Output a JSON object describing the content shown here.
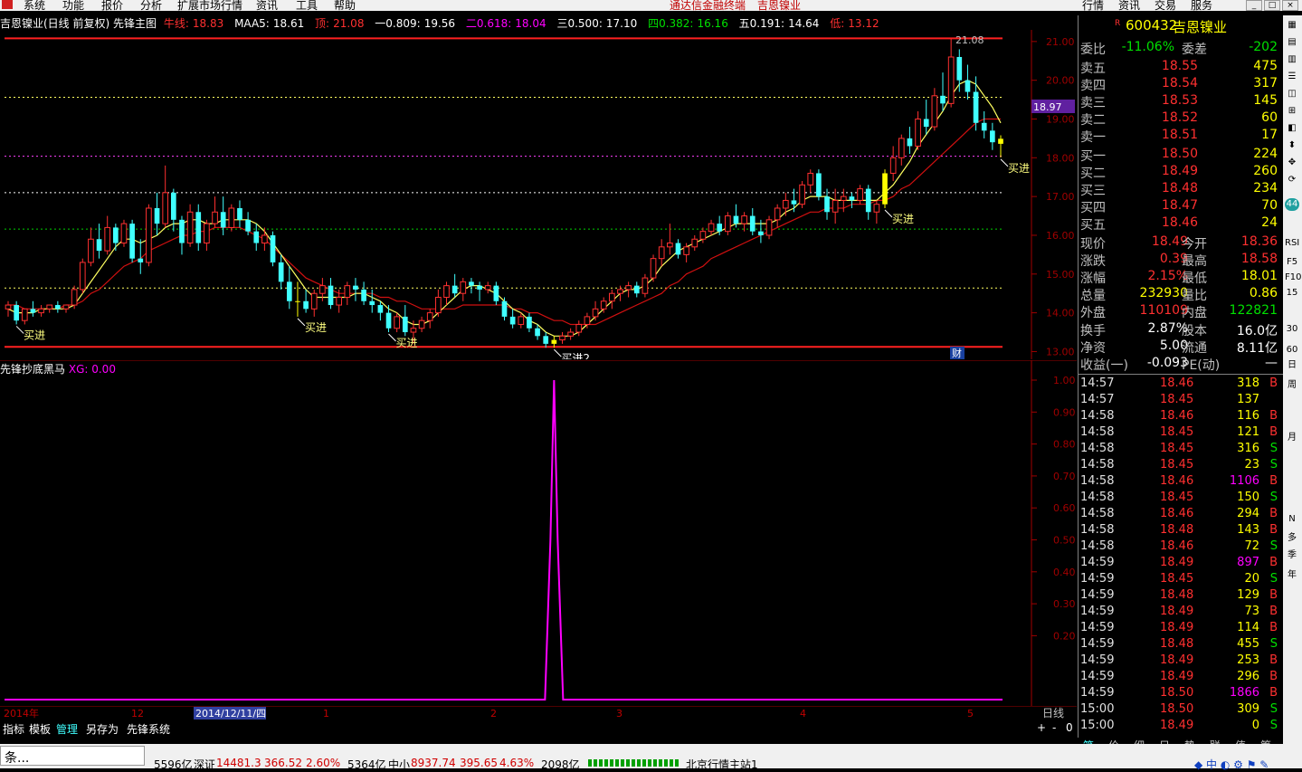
{
  "menu": {
    "items": [
      "系统",
      "功能",
      "报价",
      "分析",
      "扩展市场行情",
      "资讯",
      "工具",
      "帮助"
    ],
    "center_title": "通达信金融终端",
    "center_stock": "吉恩镍业",
    "right_items": [
      "行情",
      "资讯",
      "交易",
      "服务"
    ]
  },
  "main_header": {
    "title": "吉恩镍业(日线 前复权) 先锋主图",
    "niuxian_label": "牛线:",
    "niuxian_value": "18.83",
    "maa5_label": "MAA5:",
    "maa5_value": "18.61",
    "top_label": "顶:",
    "top_value": "21.08",
    "l1_label": "一0.809:",
    "l1_value": "19.56",
    "l2_label": "二0.618:",
    "l2_value": "18.04",
    "l3_label": "三0.500:",
    "l3_value": "17.10",
    "l4_label": "四0.382:",
    "l4_value": "16.16",
    "l5_label": "五0.191:",
    "l5_value": "14.64",
    "low_label": "低:",
    "low_value": "13.12"
  },
  "sub_header": {
    "title": "先锋抄底黑马",
    "xg_label": "XG:",
    "xg_value": "0.00"
  },
  "price_axis": [
    "21.00",
    "20.00",
    "19.00",
    "18.00",
    "17.00",
    "16.00",
    "15.00",
    "14.00",
    "13.00"
  ],
  "current_price_tag": "18.97",
  "sub_axis": [
    "1.00",
    "0.90",
    "0.80",
    "0.70",
    "0.60",
    "0.50",
    "0.40",
    "0.30",
    "0.20"
  ],
  "date_axis": [
    "2014年",
    "12",
    "2014/12/11/四",
    "1",
    "2",
    "3",
    "4",
    "5"
  ],
  "date_axis_right": "日线",
  "chart_annotations": {
    "buy": "买进",
    "buy2": "买进2",
    "high_label": "21.08",
    "finance": "财"
  },
  "chart_data": {
    "type": "candlestick",
    "ylim": [
      12.8,
      21.3
    ],
    "candles": [
      [
        14.1,
        14.3,
        13.9,
        14.2
      ],
      [
        14.2,
        14.3,
        13.7,
        13.8
      ],
      [
        13.8,
        14.1,
        13.7,
        14.1
      ],
      [
        14.1,
        14.3,
        13.9,
        14.0
      ],
      [
        14.0,
        14.2,
        13.9,
        14.1
      ],
      [
        14.1,
        14.2,
        14.0,
        14.2
      ],
      [
        14.2,
        14.3,
        14.0,
        14.1
      ],
      [
        14.1,
        14.2,
        14.0,
        14.2
      ],
      [
        14.2,
        14.7,
        14.1,
        14.6
      ],
      [
        14.6,
        15.4,
        14.5,
        15.3
      ],
      [
        15.3,
        16.2,
        15.2,
        15.9
      ],
      [
        15.9,
        16.3,
        15.4,
        15.6
      ],
      [
        15.6,
        16.5,
        15.5,
        16.2
      ],
      [
        16.2,
        16.3,
        15.6,
        15.8
      ],
      [
        15.8,
        16.4,
        15.7,
        16.3
      ],
      [
        16.3,
        16.4,
        15.3,
        15.4
      ],
      [
        15.4,
        15.9,
        15.0,
        15.3
      ],
      [
        15.3,
        16.8,
        15.2,
        16.7
      ],
      [
        16.7,
        17.1,
        16.0,
        16.3
      ],
      [
        16.3,
        17.8,
        16.2,
        17.1
      ],
      [
        17.1,
        17.2,
        16.1,
        16.4
      ],
      [
        16.4,
        16.5,
        15.5,
        15.8
      ],
      [
        15.8,
        16.8,
        15.7,
        16.6
      ],
      [
        16.6,
        16.8,
        15.6,
        15.8
      ],
      [
        15.8,
        16.4,
        15.6,
        16.3
      ],
      [
        16.3,
        17.0,
        16.2,
        16.6
      ],
      [
        16.6,
        17.0,
        16.0,
        16.2
      ],
      [
        16.2,
        16.8,
        16.1,
        16.7
      ],
      [
        16.7,
        16.9,
        16.2,
        16.4
      ],
      [
        16.4,
        16.6,
        16.0,
        16.1
      ],
      [
        16.1,
        16.3,
        15.6,
        15.8
      ],
      [
        15.8,
        16.2,
        15.6,
        16.0
      ],
      [
        16.0,
        16.1,
        15.2,
        15.3
      ],
      [
        15.3,
        15.5,
        14.6,
        14.8
      ],
      [
        14.8,
        15.2,
        14.1,
        14.3
      ],
      [
        14.3,
        14.8,
        13.9,
        14.3
      ],
      [
        14.3,
        14.6,
        14.0,
        14.1
      ],
      [
        14.1,
        14.6,
        13.9,
        14.5
      ],
      [
        14.5,
        14.9,
        14.3,
        14.7
      ],
      [
        14.7,
        14.9,
        14.1,
        14.2
      ],
      [
        14.2,
        14.6,
        14.0,
        14.4
      ],
      [
        14.4,
        14.8,
        14.2,
        14.7
      ],
      [
        14.7,
        14.9,
        14.3,
        14.6
      ],
      [
        14.6,
        14.8,
        14.2,
        14.3
      ],
      [
        14.3,
        14.6,
        14.0,
        14.2
      ],
      [
        14.2,
        14.3,
        13.8,
        14.0
      ],
      [
        14.0,
        14.2,
        13.5,
        13.6
      ],
      [
        13.6,
        14.0,
        13.5,
        13.9
      ],
      [
        13.9,
        14.2,
        13.4,
        13.5
      ],
      [
        13.5,
        13.8,
        13.2,
        13.6
      ],
      [
        13.6,
        13.9,
        13.5,
        13.8
      ],
      [
        13.8,
        14.1,
        13.6,
        14.0
      ],
      [
        14.0,
        14.6,
        13.9,
        14.4
      ],
      [
        14.4,
        14.8,
        14.2,
        14.7
      ],
      [
        14.7,
        15.0,
        14.4,
        14.5
      ],
      [
        14.5,
        14.9,
        14.3,
        14.8
      ],
      [
        14.8,
        14.9,
        14.5,
        14.7
      ],
      [
        14.7,
        14.8,
        14.3,
        14.6
      ],
      [
        14.6,
        14.8,
        14.5,
        14.7
      ],
      [
        14.7,
        14.8,
        14.2,
        14.3
      ],
      [
        14.3,
        14.4,
        13.8,
        13.9
      ],
      [
        13.9,
        14.1,
        13.6,
        13.7
      ],
      [
        13.7,
        14.0,
        13.6,
        13.9
      ],
      [
        13.9,
        14.0,
        13.5,
        13.6
      ],
      [
        13.6,
        13.7,
        13.3,
        13.4
      ],
      [
        13.4,
        13.5,
        13.1,
        13.2
      ],
      [
        13.2,
        13.4,
        13.1,
        13.3
      ],
      [
        13.3,
        13.5,
        13.2,
        13.4
      ],
      [
        13.4,
        13.6,
        13.3,
        13.5
      ],
      [
        13.5,
        13.8,
        13.4,
        13.7
      ],
      [
        13.7,
        14.0,
        13.6,
        13.9
      ],
      [
        13.9,
        14.3,
        13.8,
        14.1
      ],
      [
        14.1,
        14.4,
        14.0,
        14.3
      ],
      [
        14.3,
        14.6,
        14.1,
        14.5
      ],
      [
        14.5,
        14.7,
        14.3,
        14.6
      ],
      [
        14.6,
        14.8,
        14.4,
        14.7
      ],
      [
        14.7,
        14.8,
        14.4,
        14.5
      ],
      [
        14.5,
        15.0,
        14.4,
        14.9
      ],
      [
        14.9,
        15.5,
        14.8,
        15.4
      ],
      [
        15.4,
        15.9,
        15.2,
        15.7
      ],
      [
        15.7,
        16.3,
        15.5,
        15.8
      ],
      [
        15.8,
        15.9,
        15.4,
        15.5
      ],
      [
        15.5,
        15.8,
        15.3,
        15.7
      ],
      [
        15.7,
        16.0,
        15.6,
        15.9
      ],
      [
        15.9,
        16.2,
        15.8,
        16.1
      ],
      [
        16.1,
        16.4,
        16.0,
        16.3
      ],
      [
        16.3,
        16.5,
        16.0,
        16.1
      ],
      [
        16.1,
        16.6,
        16.0,
        16.5
      ],
      [
        16.5,
        16.8,
        16.2,
        16.3
      ],
      [
        16.3,
        16.6,
        16.1,
        16.5
      ],
      [
        16.5,
        16.7,
        16.0,
        16.1
      ],
      [
        16.1,
        16.4,
        15.8,
        16.0
      ],
      [
        16.0,
        16.5,
        15.9,
        16.4
      ],
      [
        16.4,
        16.8,
        16.2,
        16.7
      ],
      [
        16.7,
        17.1,
        16.5,
        16.9
      ],
      [
        16.9,
        17.2,
        16.6,
        16.8
      ],
      [
        16.8,
        17.4,
        16.7,
        17.3
      ],
      [
        17.3,
        17.7,
        17.1,
        17.6
      ],
      [
        17.6,
        17.7,
        16.9,
        17.0
      ],
      [
        17.0,
        17.2,
        16.4,
        16.6
      ],
      [
        16.6,
        17.2,
        16.3,
        16.9
      ],
      [
        16.9,
        17.2,
        16.6,
        17.0
      ],
      [
        17.0,
        17.1,
        16.7,
        16.9
      ],
      [
        16.9,
        17.3,
        16.8,
        17.2
      ],
      [
        17.2,
        17.3,
        16.4,
        16.6
      ],
      [
        16.6,
        16.9,
        16.3,
        16.8
      ],
      [
        16.8,
        17.7,
        16.7,
        17.6
      ],
      [
        17.6,
        18.3,
        17.4,
        18.0
      ],
      [
        18.0,
        18.6,
        17.8,
        18.5
      ],
      [
        18.5,
        18.8,
        18.1,
        18.3
      ],
      [
        18.3,
        19.2,
        18.2,
        19.0
      ],
      [
        19.0,
        19.5,
        18.6,
        18.8
      ],
      [
        18.8,
        19.8,
        18.7,
        19.6
      ],
      [
        19.6,
        20.2,
        19.2,
        19.4
      ],
      [
        19.4,
        21.08,
        19.3,
        20.6
      ],
      [
        20.6,
        20.8,
        19.7,
        20.0
      ],
      [
        20.0,
        20.4,
        19.5,
        19.7
      ],
      [
        19.7,
        20.1,
        18.7,
        18.9
      ],
      [
        18.9,
        19.2,
        18.5,
        18.7
      ],
      [
        18.7,
        18.9,
        18.2,
        18.4
      ],
      [
        18.36,
        18.58,
        18.01,
        18.49
      ]
    ],
    "ma_fast": [
      14.1,
      14.0,
      14.0,
      14.0,
      14.1,
      14.1,
      14.1,
      14.1,
      14.2,
      14.5,
      14.8,
      15.1,
      15.4,
      15.7,
      15.9,
      15.9,
      15.8,
      15.9,
      16.0,
      16.2,
      16.3,
      16.3,
      16.4,
      16.4,
      16.3,
      16.3,
      16.4,
      16.4,
      16.4,
      16.4,
      16.3,
      16.1,
      15.8,
      15.5,
      15.2,
      14.9,
      14.6,
      14.4,
      14.4,
      14.4,
      14.4,
      14.4,
      14.5,
      14.5,
      14.4,
      14.3,
      14.1,
      14.0,
      13.8,
      13.7,
      13.7,
      13.8,
      14.0,
      14.2,
      14.4,
      14.6,
      14.7,
      14.7,
      14.6,
      14.5,
      14.3,
      14.1,
      14.0,
      13.8,
      13.7,
      13.5,
      13.4,
      13.4,
      13.4,
      13.5,
      13.7,
      13.9,
      14.1,
      14.3,
      14.5,
      14.6,
      14.6,
      14.7,
      14.9,
      15.2,
      15.4,
      15.6,
      15.7,
      15.8,
      15.9,
      16.0,
      16.1,
      16.2,
      16.3,
      16.3,
      16.3,
      16.3,
      16.3,
      16.4,
      16.6,
      16.7,
      16.9,
      17.0,
      17.0,
      17.0,
      16.9,
      16.9,
      16.9,
      16.9,
      16.9,
      16.9,
      17.1,
      17.3,
      17.6,
      17.9,
      18.3,
      18.6,
      18.9,
      19.2,
      19.6,
      19.9,
      20.0,
      19.9,
      19.6,
      19.3,
      18.9
    ],
    "ma_slow": [
      14.2,
      14.2,
      14.1,
      14.1,
      14.1,
      14.1,
      14.1,
      14.2,
      14.2,
      14.3,
      14.5,
      14.6,
      14.8,
      15.0,
      15.2,
      15.3,
      15.4,
      15.6,
      15.7,
      15.8,
      15.9,
      16.0,
      16.0,
      16.1,
      16.1,
      16.2,
      16.2,
      16.2,
      16.2,
      16.1,
      16.0,
      15.9,
      15.7,
      15.5,
      15.3,
      15.1,
      14.9,
      14.8,
      14.7,
      14.6,
      14.5,
      14.5,
      14.5,
      14.5,
      14.5,
      14.4,
      14.4,
      14.3,
      14.3,
      14.2,
      14.1,
      14.1,
      14.1,
      14.1,
      14.1,
      14.2,
      14.2,
      14.2,
      14.2,
      14.2,
      14.2,
      14.1,
      14.1,
      14.0,
      14.0,
      13.9,
      13.8,
      13.8,
      13.7,
      13.7,
      13.7,
      13.7,
      13.8,
      13.9,
      14.0,
      14.1,
      14.2,
      14.3,
      14.4,
      14.5,
      14.7,
      14.8,
      15.0,
      15.1,
      15.2,
      15.4,
      15.5,
      15.6,
      15.7,
      15.8,
      15.9,
      16.0,
      16.1,
      16.2,
      16.3,
      16.4,
      16.5,
      16.6,
      16.6,
      16.7,
      16.7,
      16.7,
      16.8,
      16.8,
      16.8,
      16.9,
      16.9,
      17.0,
      17.2,
      17.3,
      17.5,
      17.7,
      17.9,
      18.1,
      18.3,
      18.5,
      18.7,
      18.9,
      19.0,
      19.0,
      19.0
    ],
    "levels": [
      {
        "name": "顶",
        "value": 21.08,
        "color": "#ff2020"
      },
      {
        "name": "一0.809",
        "value": 19.56,
        "color": "#ffff60"
      },
      {
        "name": "二0.618",
        "value": 18.04,
        "color": "#ff40ff"
      },
      {
        "name": "三0.500",
        "value": 17.1,
        "color": "#ffffff"
      },
      {
        "name": "四0.382",
        "value": 16.16,
        "color": "#00d000"
      },
      {
        "name": "五0.191",
        "value": 14.64,
        "color": "#ffff60"
      },
      {
        "name": "低",
        "value": 13.12,
        "color": "#ff2020"
      }
    ],
    "buy_signals": [
      1,
      35,
      46,
      66,
      106,
      120
    ],
    "xg_series": {
      "spike_index": 66,
      "spike_value": 1.0,
      "baseline": 0.0
    },
    "xg_ylim": [
      0,
      1.0
    ]
  },
  "quote": {
    "code": "600432",
    "name": "吉恩镍业",
    "weibi_label": "委比",
    "weibi_value": "-11.06%",
    "weicha_label": "委差",
    "weicha_value": "-202",
    "asks": [
      {
        "label": "卖五",
        "price": "18.55",
        "vol": "475"
      },
      {
        "label": "卖四",
        "price": "18.54",
        "vol": "317"
      },
      {
        "label": "卖三",
        "price": "18.53",
        "vol": "145"
      },
      {
        "label": "卖二",
        "price": "18.52",
        "vol": "60"
      },
      {
        "label": "卖一",
        "price": "18.51",
        "vol": "17"
      }
    ],
    "bids": [
      {
        "label": "买一",
        "price": "18.50",
        "vol": "224"
      },
      {
        "label": "买二",
        "price": "18.49",
        "vol": "260"
      },
      {
        "label": "买三",
        "price": "18.48",
        "vol": "234"
      },
      {
        "label": "买四",
        "price": "18.47",
        "vol": "70"
      },
      {
        "label": "买五",
        "price": "18.46",
        "vol": "24"
      }
    ],
    "stats": [
      {
        "l1": "现价",
        "v1": "18.49",
        "c1": "red",
        "l2": "今开",
        "v2": "18.36",
        "c2": "red"
      },
      {
        "l1": "涨跌",
        "v1": "0.39",
        "c1": "red",
        "l2": "最高",
        "v2": "18.58",
        "c2": "red"
      },
      {
        "l1": "涨幅",
        "v1": "2.15%",
        "c1": "red",
        "l2": "最低",
        "v2": "18.01",
        "c2": "yellow"
      },
      {
        "l1": "总量",
        "v1": "232930",
        "c1": "yellow",
        "l2": "量比",
        "v2": "0.86",
        "c2": "yellow"
      },
      {
        "l1": "外盘",
        "v1": "110109",
        "c1": "red",
        "l2": "内盘",
        "v2": "122821",
        "c2": "green"
      },
      {
        "l1": "换手",
        "v1": "2.87%",
        "c1": "white",
        "l2": "股本",
        "v2": "16.0亿",
        "c2": "white"
      },
      {
        "l1": "净资",
        "v1": "5.00",
        "c1": "white",
        "l2": "流通",
        "v2": "8.11亿",
        "c2": "white"
      },
      {
        "l1": "收益(一)",
        "v1": "-0.093",
        "c1": "white",
        "l2": "PE(动)",
        "v2": "—",
        "c2": "white"
      }
    ],
    "ticks": [
      {
        "t": "14:57",
        "p": "18.46",
        "v": "318",
        "bs": "B"
      },
      {
        "t": "14:57",
        "p": "18.45",
        "v": "137",
        "bs": ""
      },
      {
        "t": "14:58",
        "p": "18.46",
        "v": "116",
        "bs": "B"
      },
      {
        "t": "14:58",
        "p": "18.45",
        "v": "121",
        "bs": "B"
      },
      {
        "t": "14:58",
        "p": "18.45",
        "v": "316",
        "bs": "S"
      },
      {
        "t": "14:58",
        "p": "18.45",
        "v": "23",
        "bs": "S"
      },
      {
        "t": "14:58",
        "p": "18.46",
        "v": "1106",
        "bs": "B"
      },
      {
        "t": "14:58",
        "p": "18.45",
        "v": "150",
        "bs": "S"
      },
      {
        "t": "14:58",
        "p": "18.46",
        "v": "294",
        "bs": "B"
      },
      {
        "t": "14:58",
        "p": "18.48",
        "v": "143",
        "bs": "B"
      },
      {
        "t": "14:58",
        "p": "18.46",
        "v": "72",
        "bs": "S"
      },
      {
        "t": "14:59",
        "p": "18.49",
        "v": "897",
        "bs": "B"
      },
      {
        "t": "14:59",
        "p": "18.45",
        "v": "20",
        "bs": "S"
      },
      {
        "t": "14:59",
        "p": "18.48",
        "v": "129",
        "bs": "B"
      },
      {
        "t": "14:59",
        "p": "18.49",
        "v": "73",
        "bs": "B"
      },
      {
        "t": "14:59",
        "p": "18.49",
        "v": "114",
        "bs": "B"
      },
      {
        "t": "14:59",
        "p": "18.48",
        "v": "455",
        "bs": "S"
      },
      {
        "t": "14:59",
        "p": "18.49",
        "v": "253",
        "bs": "B"
      },
      {
        "t": "14:59",
        "p": "18.49",
        "v": "296",
        "bs": "B"
      },
      {
        "t": "14:59",
        "p": "18.50",
        "v": "1866",
        "bs": "B"
      },
      {
        "t": "15:00",
        "p": "18.50",
        "v": "309",
        "bs": "S"
      },
      {
        "t": "15:00",
        "p": "18.49",
        "v": "0",
        "bs": "S"
      }
    ],
    "panel_tabs": [
      "笔",
      "价",
      "细",
      "日",
      "势",
      "联",
      "值",
      "筹"
    ]
  },
  "side_strip": [
    "44",
    "RSI",
    "F5",
    "F10",
    "15",
    "30",
    "60",
    "日",
    "周",
    "月",
    "N",
    "多",
    "季",
    "年"
  ],
  "bottom_tabs": [
    "指标",
    "模板",
    "管理",
    "另存为",
    "先锋系统"
  ],
  "bottom_right": [
    "+",
    "-",
    "0"
  ],
  "statusbar": {
    "left_item": "条...",
    "items": [
      "5596亿",
      "深证",
      "14481.3",
      "366.52",
      "2.60%",
      "5364亿",
      "中小",
      "8937.74",
      "395.65",
      "4.63%",
      "2098亿",
      "北京行情主站1"
    ]
  }
}
